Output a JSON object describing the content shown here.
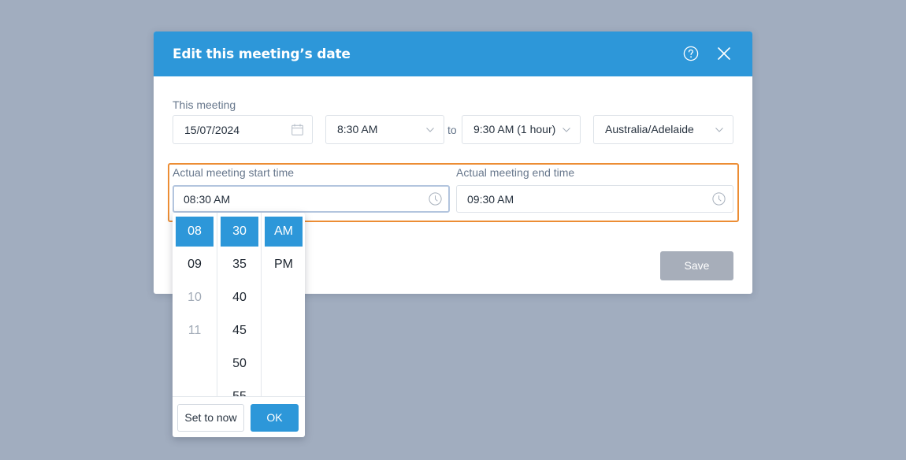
{
  "modal": {
    "title": "Edit this meeting’s date",
    "this_meeting_label": "This meeting",
    "date_value": "15/07/2024",
    "start_time": "8:30 AM",
    "to_label": "to",
    "end_time": "9:30 AM (1 hour)",
    "timezone": "Australia/Adelaide",
    "actual_start_label": "Actual meeting start time",
    "actual_start_value": "08:30 AM",
    "actual_end_label": "Actual meeting end time",
    "actual_end_value": "09:30 AM",
    "save_label": "Save"
  },
  "picker": {
    "hours": [
      "08",
      "09",
      "10",
      "11"
    ],
    "minutes": [
      "30",
      "35",
      "40",
      "45",
      "50",
      "55"
    ],
    "periods": [
      "AM",
      "PM"
    ],
    "selected_hour": "08",
    "selected_minute": "30",
    "selected_period": "AM",
    "set_now_label": "Set to now",
    "ok_label": "OK"
  },
  "colors": {
    "accent": "#2d97d9",
    "highlight_border": "#ec8d34",
    "backdrop": "#a1adbf",
    "disabled_button": "#a7aeba"
  },
  "icons": [
    "help-icon",
    "close-icon",
    "calendar-icon",
    "chevron-down-icon",
    "clock-icon"
  ]
}
